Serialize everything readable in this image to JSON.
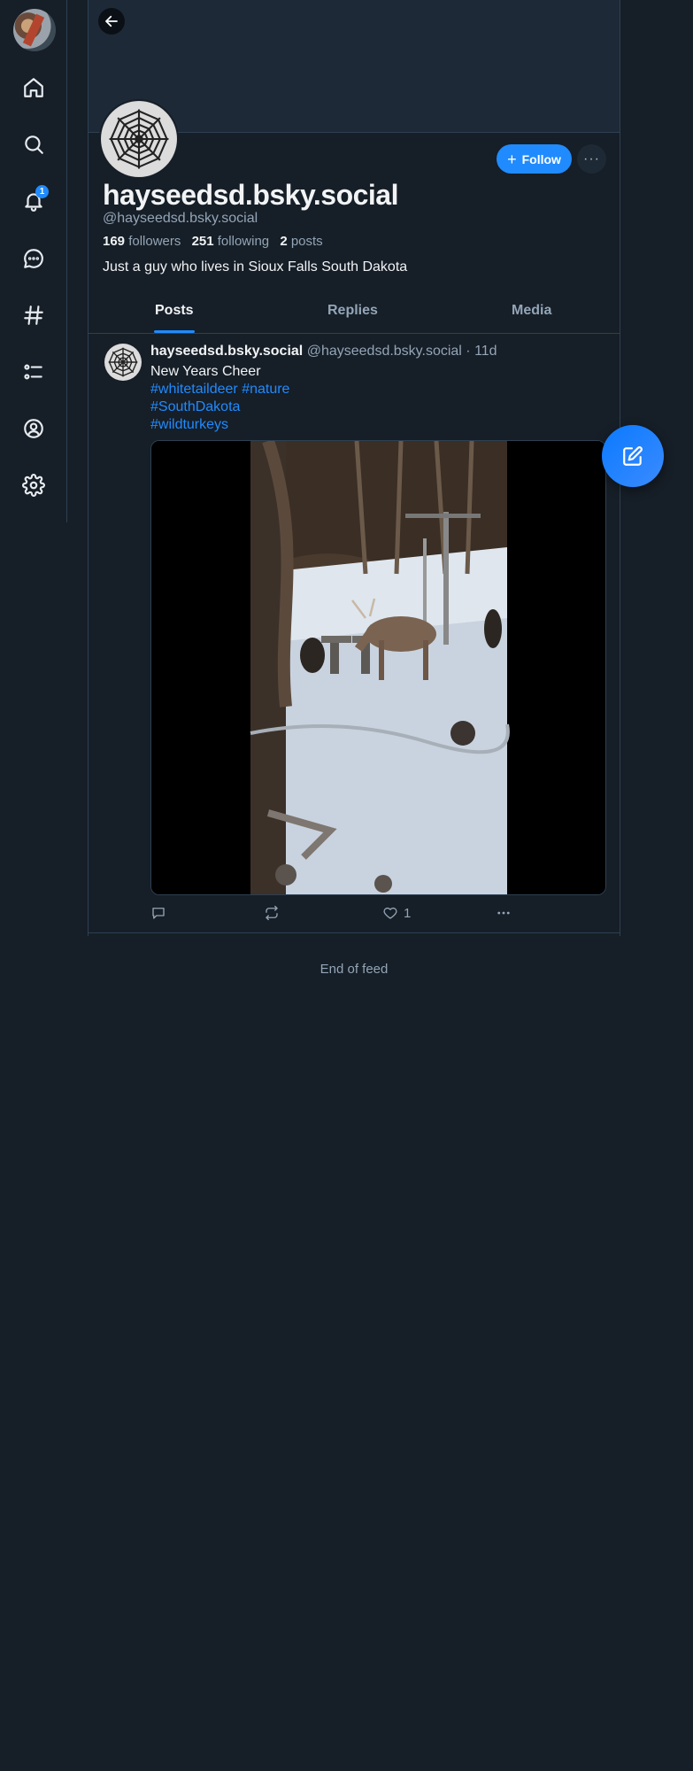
{
  "nav": {
    "notification_count": "1",
    "items": [
      "home-icon",
      "search-icon",
      "bell-icon",
      "chat-icon",
      "hashtag-icon",
      "list-icon",
      "profile-icon",
      "gear-icon"
    ]
  },
  "profile": {
    "display_name": "hayseedsd.bsky.social",
    "handle": "@hayseedsd.bsky.social",
    "followers_count": "169",
    "followers_label": "followers",
    "following_count": "251",
    "following_label": "following",
    "posts_count": "2",
    "posts_label": "posts",
    "bio": "Just a guy who lives in Sioux Falls South Dakota",
    "follow_label": "Follow",
    "more_label": "···"
  },
  "tabs": [
    {
      "label": "Posts",
      "active": true
    },
    {
      "label": "Replies",
      "active": false
    },
    {
      "label": "Media",
      "active": false
    }
  ],
  "post": {
    "author_name": "hayseedsd.bsky.social",
    "author_handle": "@hayseedsd.bsky.social",
    "time": "· 11d",
    "text": "New Years Cheer",
    "tags_line1a": "#whitetaildeer",
    "tags_line1b": "#nature",
    "tag2": "#SouthDakota",
    "tag3": "#wildturkeys",
    "like_count": "1"
  },
  "feed_end": "End of feed",
  "colors": {
    "background": "#161e27",
    "accent": "#208bfe",
    "muted_text": "#93a5b7",
    "border": "#2e4052"
  }
}
